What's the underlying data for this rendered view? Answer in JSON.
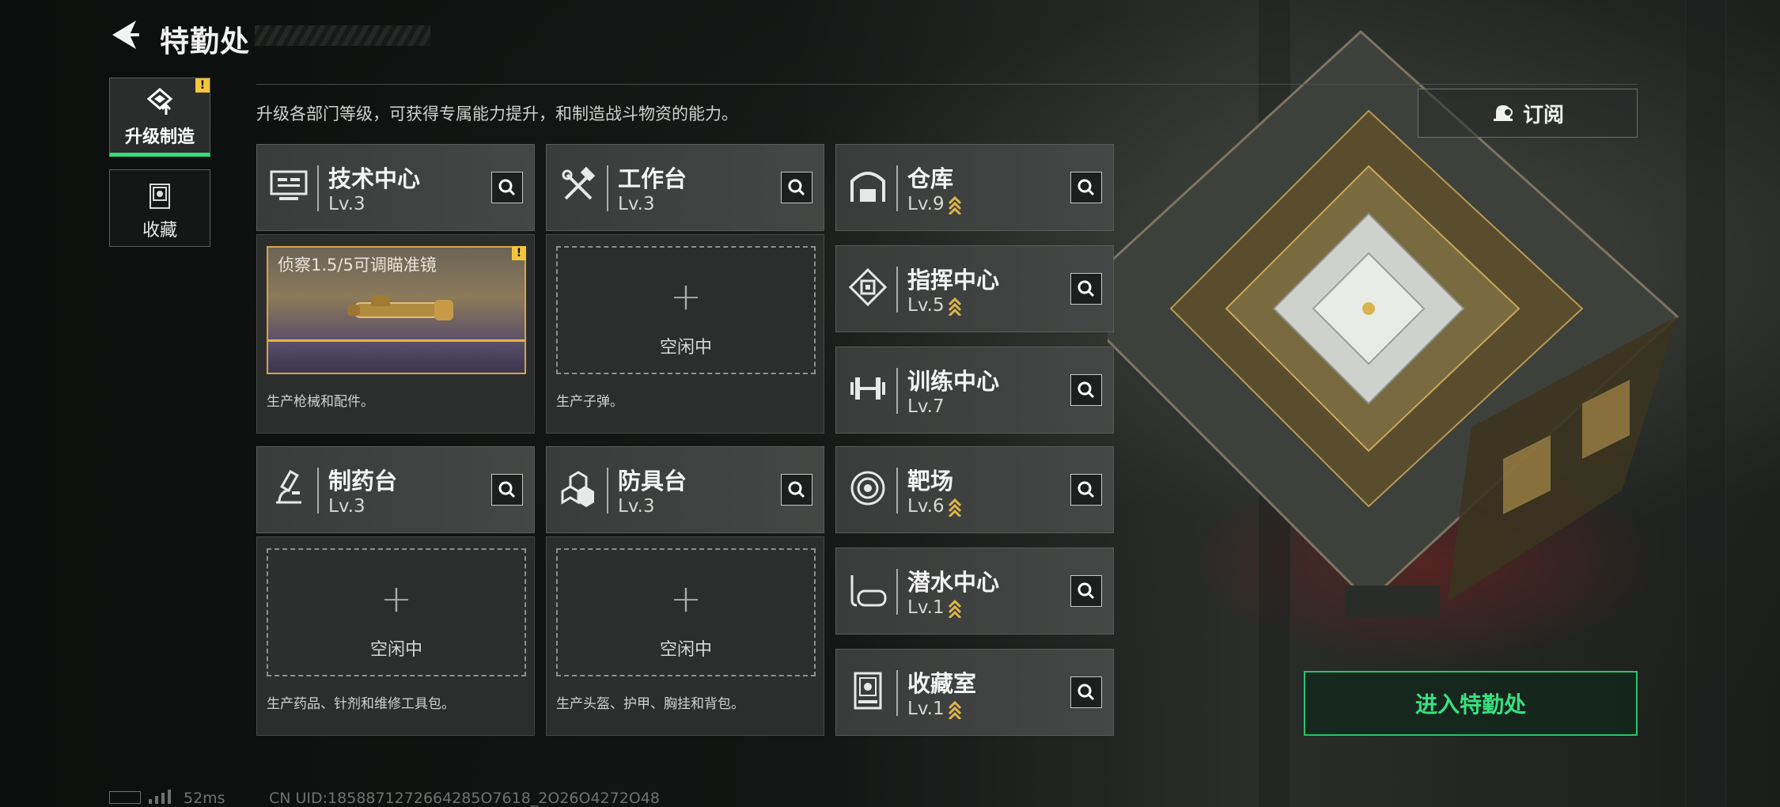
{
  "header": {
    "title": "特勤处",
    "subtitle": "升级各部门等级，可获得专属能力提升，和制造战斗物资的能力。"
  },
  "sidebar": {
    "items": [
      {
        "label": "升级制造",
        "active": true,
        "alert": "!"
      },
      {
        "label": "收藏",
        "active": false
      }
    ]
  },
  "departments": [
    {
      "name": "技术中心",
      "level": "Lv.3",
      "icon": "tech-center-icon"
    },
    {
      "name": "工作台",
      "level": "Lv.3",
      "icon": "hammer-wrench-icon"
    },
    {
      "name": "仓库",
      "level": "Lv.9",
      "icon": "warehouse-icon",
      "upgrade": true
    },
    {
      "name": "制药台",
      "level": "Lv.3",
      "icon": "microscope-icon"
    },
    {
      "name": "防具台",
      "level": "Lv.3",
      "icon": "cubes-icon"
    },
    {
      "name": "指挥中心",
      "level": "Lv.5",
      "icon": "command-chip-icon",
      "upgrade": true
    },
    {
      "name": "训练中心",
      "level": "Lv.7",
      "icon": "dumbbell-icon"
    },
    {
      "name": "靶场",
      "level": "Lv.6",
      "icon": "target-icon",
      "upgrade": true
    },
    {
      "name": "潜水中心",
      "level": "Lv.1",
      "icon": "diving-mask-icon",
      "upgrade": true
    },
    {
      "name": "收藏室",
      "level": "Lv.1",
      "icon": "trophy-case-icon",
      "upgrade": true
    }
  ],
  "production": {
    "tech": {
      "item_name": "侦察1.5/5可调瞄准镜",
      "alert": "!",
      "desc": "生产枪械和配件。"
    },
    "workbench": {
      "idle": "空闲中",
      "desc": "生产子弹。"
    },
    "pharmacy": {
      "idle": "空闲中",
      "desc": "生产药品、针剂和维修工具包。"
    },
    "armor": {
      "idle": "空闲中",
      "desc": "生产头盔、护甲、胸挂和背包。"
    }
  },
  "actions": {
    "subscribe_label": "订阅",
    "enter_label": "进入特勤处"
  },
  "footer": {
    "ping": "52ms",
    "uid": "CN UID:1858871272664285O7618_2O26O4272O48"
  },
  "colors": {
    "accent_green": "#2ee07a",
    "upgrade_gold": "#e0b54a",
    "warning_yellow": "#f3c63a"
  }
}
